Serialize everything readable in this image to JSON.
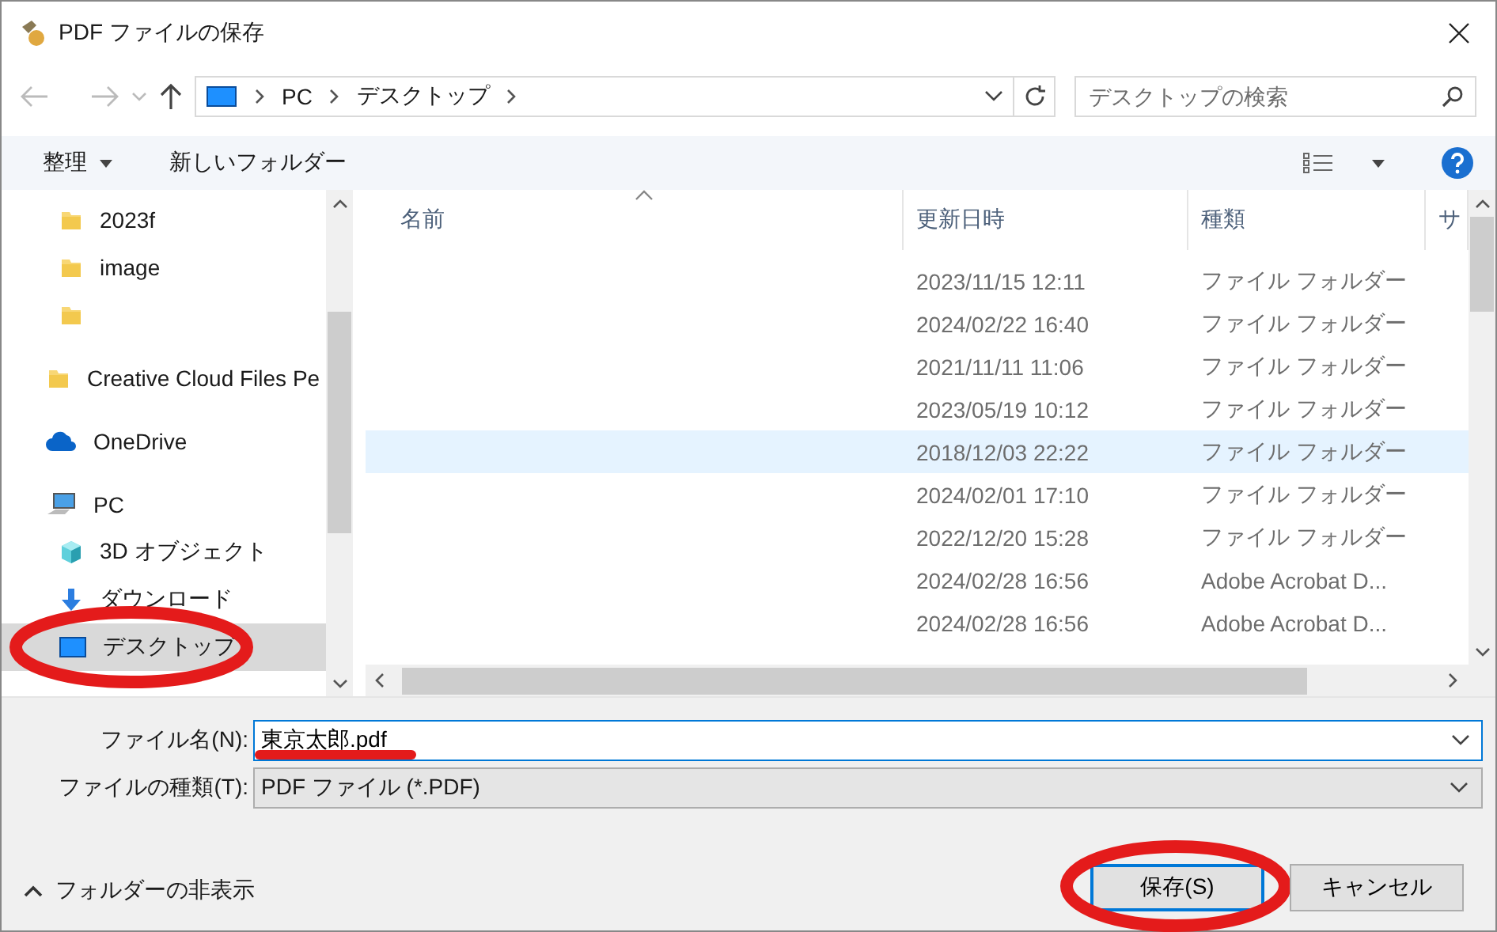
{
  "window": {
    "title": "PDF ファイルの保存"
  },
  "address_bar": {
    "crumbs": [
      "PC",
      "デスクトップ"
    ]
  },
  "search": {
    "placeholder": "デスクトップの検索"
  },
  "toolbar": {
    "organize": "整理",
    "new_folder": "新しいフォルダー"
  },
  "nav_tree": [
    {
      "children": [
        {
          "label": "2023f",
          "kind": "folder"
        },
        {
          "label": "image",
          "kind": "folder"
        },
        {
          "kind": "folder"
        }
      ]
    },
    {
      "label": "Creative Cloud Files Pe",
      "kind": "folder"
    },
    {
      "label": "OneDrive",
      "kind": "cloud"
    },
    {
      "label": "PC",
      "kind": "pc",
      "children": [
        {
          "label": "3D オブジェクト",
          "kind": "cube",
          "selected": false,
          "circled": false
        },
        {
          "label": "ダウンロード",
          "kind": "download",
          "selected": false,
          "circled": false
        },
        {
          "label": "デスクトップ",
          "kind": "desktop",
          "selected": true,
          "circled": true
        }
      ]
    }
  ],
  "table": {
    "columns": [
      "名前",
      "更新日時",
      "種類",
      "サ"
    ],
    "rows": [
      {
        "modified": "2023/11/15 12:11",
        "type": "ファイル フォルダー",
        "selected": false
      },
      {
        "modified": "2024/02/22 16:40",
        "type": "ファイル フォルダー",
        "selected": false
      },
      {
        "modified": "2021/11/11 11:06",
        "type": "ファイル フォルダー",
        "selected": false
      },
      {
        "modified": "2023/05/19 10:12",
        "type": "ファイル フォルダー",
        "selected": false
      },
      {
        "modified": "2018/12/03 22:22",
        "type": "ファイル フォルダー",
        "selected": true
      },
      {
        "modified": "2024/02/01 17:10",
        "type": "ファイル フォルダー",
        "selected": false
      },
      {
        "modified": "2022/12/20 15:28",
        "type": "ファイル フォルダー",
        "selected": false
      },
      {
        "modified": "2024/02/28 16:56",
        "type": "Adobe Acrobat D...",
        "selected": false
      },
      {
        "modified": "2024/02/28 16:56",
        "type": "Adobe Acrobat D...",
        "selected": false
      }
    ]
  },
  "file_name": {
    "label": "ファイル名(N):",
    "value": "東京太郎.pdf",
    "underlined": true
  },
  "file_type": {
    "label": "ファイルの種類(T):",
    "value": "PDF ファイル (*.PDF)"
  },
  "hide_folders": "フォルダーの非表示",
  "buttons": [
    {
      "label": "保存(S)",
      "kind": "primary",
      "circled": true
    },
    {
      "label": "キャンセル",
      "kind": "cancel",
      "circled": false
    }
  ]
}
